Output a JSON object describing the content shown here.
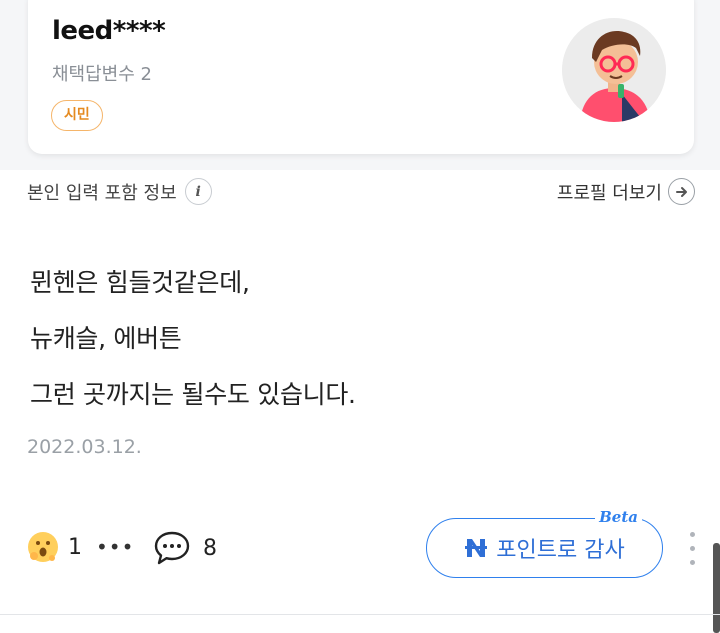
{
  "profile": {
    "username": "leed****",
    "adopted_answers": "채택답변수 2",
    "grade_badge": "시민",
    "avatar_icon": "cartoon-person-avatar"
  },
  "info_bar": {
    "self_info_label": "본인 입력 포함 정보",
    "info_icon": "info-icon",
    "profile_more_label": "프로필 더보기",
    "arrow_icon": "arrow-right-circle-icon"
  },
  "answer": {
    "lines": [
      "뮌헨은 힘들것같은데,",
      "뉴캐슬, 에버튼",
      "그런 곳까지는 될수도 있습니다."
    ],
    "date": "2022.03.12."
  },
  "actions": {
    "reaction_icon": "surprised-emoji-icon",
    "reaction_count": "1",
    "reaction_more": "•••",
    "comment_icon": "comment-bubble-icon",
    "comment_count": "8",
    "thanks_label": "포인트로 감사",
    "thanks_beta": "Beta",
    "thanks_icon": "naver-pay-n-icon",
    "more_icon": "kebab-menu-icon"
  },
  "colors": {
    "accent_blue": "#2f80ed",
    "badge_orange": "#e58a1f",
    "muted_text": "#9aa0a6"
  }
}
